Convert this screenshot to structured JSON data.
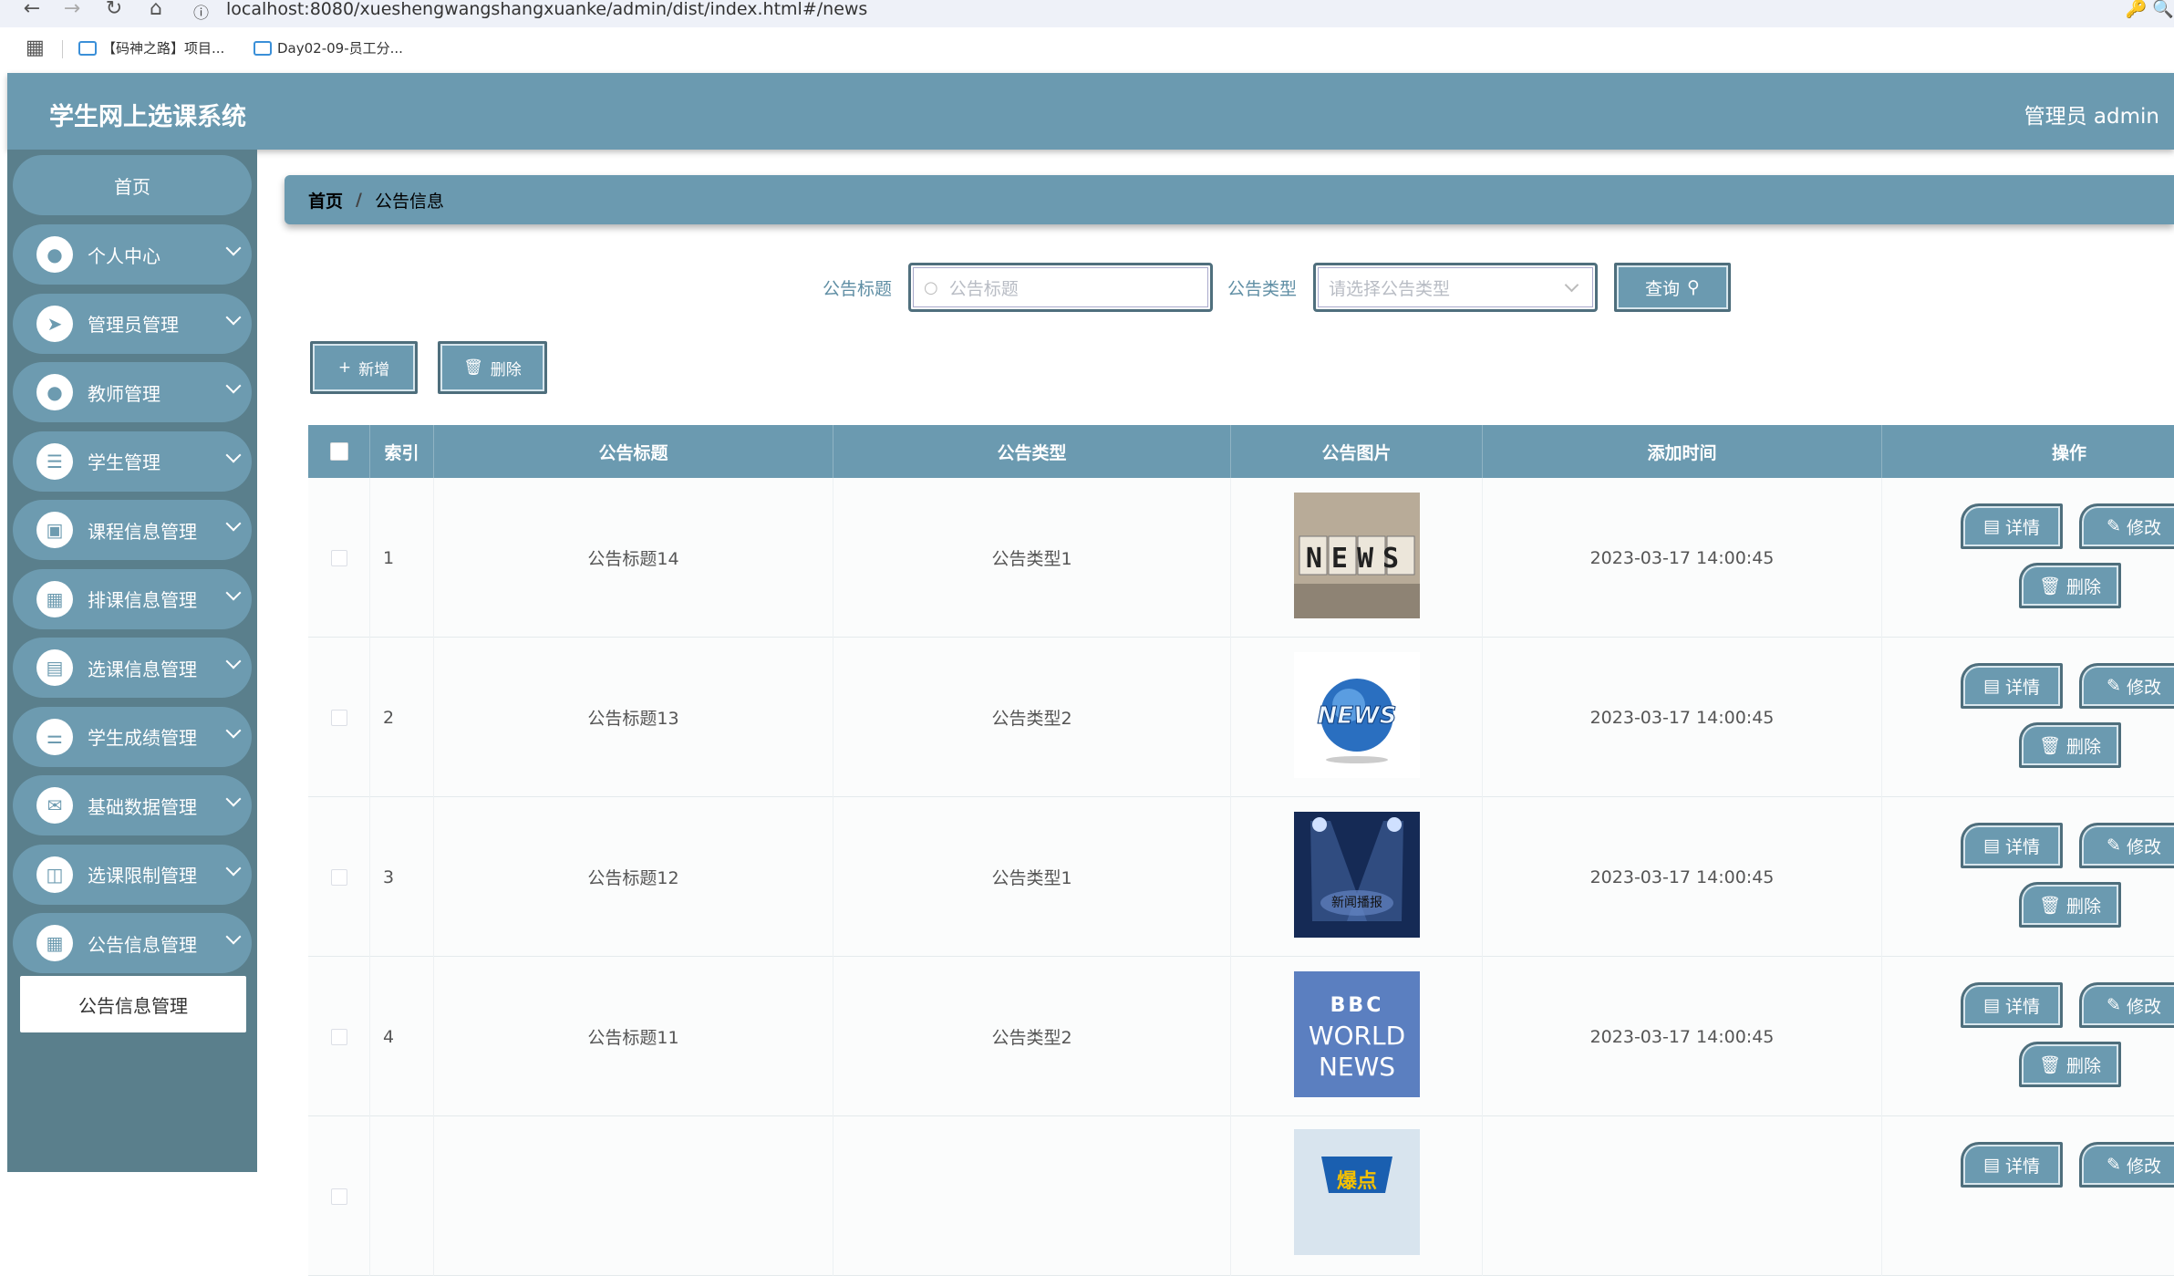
{
  "browser": {
    "url": "localhost:8080/xueshengwangshangxuanke/admin/dist/index.html#/news",
    "bookmarks": [
      "【码神之路】项目...",
      "Day02-09-员工分..."
    ]
  },
  "header": {
    "title": "学生网上选课系统",
    "user": "管理员 admin"
  },
  "sidebar": {
    "home": "首页",
    "items": [
      {
        "label": "个人中心",
        "icon": "user-icon"
      },
      {
        "label": "管理员管理",
        "icon": "send-icon"
      },
      {
        "label": "教师管理",
        "icon": "user-icon"
      },
      {
        "label": "学生管理",
        "icon": "list-icon"
      },
      {
        "label": "课程信息管理",
        "icon": "briefcase-icon"
      },
      {
        "label": "排课信息管理",
        "icon": "grid-icon"
      },
      {
        "label": "选课信息管理",
        "icon": "clipboard-icon"
      },
      {
        "label": "学生成绩管理",
        "icon": "sliders-icon"
      },
      {
        "label": "基础数据管理",
        "icon": "chat-icon"
      },
      {
        "label": "选课限制管理",
        "icon": "book-icon"
      },
      {
        "label": "公告信息管理",
        "icon": "grid-icon"
      }
    ],
    "sub_active": "公告信息管理"
  },
  "breadcrumb": {
    "home": "首页",
    "separator": "/",
    "current": "公告信息"
  },
  "filters": {
    "title_label": "公告标题",
    "title_placeholder": "公告标题",
    "type_label": "公告类型",
    "type_placeholder": "请选择公告类型",
    "search_label": "查询"
  },
  "actions": {
    "add_label": "新增",
    "delete_label": "删除"
  },
  "table": {
    "headers": [
      "索引",
      "公告标题",
      "公告类型",
      "公告图片",
      "添加时间",
      "操作"
    ],
    "rows": [
      {
        "index": "1",
        "title": "公告标题14",
        "type": "公告类型1",
        "image": "news-cubes",
        "time": "2023-03-17 14:00:45"
      },
      {
        "index": "2",
        "title": "公告标题13",
        "type": "公告类型2",
        "image": "news-globe",
        "time": "2023-03-17 14:00:45"
      },
      {
        "index": "3",
        "title": "公告标题12",
        "type": "公告类型1",
        "image": "news-stage",
        "time": "2023-03-17 14:00:45"
      },
      {
        "index": "4",
        "title": "公告标题11",
        "type": "公告类型2",
        "image": "bbc-world-news",
        "time": "2023-03-17 14:00:45"
      }
    ],
    "image_text": {
      "cubes": "NEWS",
      "globe": "NEWS",
      "stage": "新闻播报",
      "bbc_1": "BBC",
      "bbc_2": "WORLD",
      "bbc_3": "NEWS",
      "partial": "爆点"
    },
    "op_labels": {
      "detail": "详情",
      "edit": "修改",
      "delete": "删除"
    }
  },
  "colors": {
    "primary": "#6b9ab0",
    "sidebar": "#5a7f8c",
    "border": "#4e6e7c"
  }
}
